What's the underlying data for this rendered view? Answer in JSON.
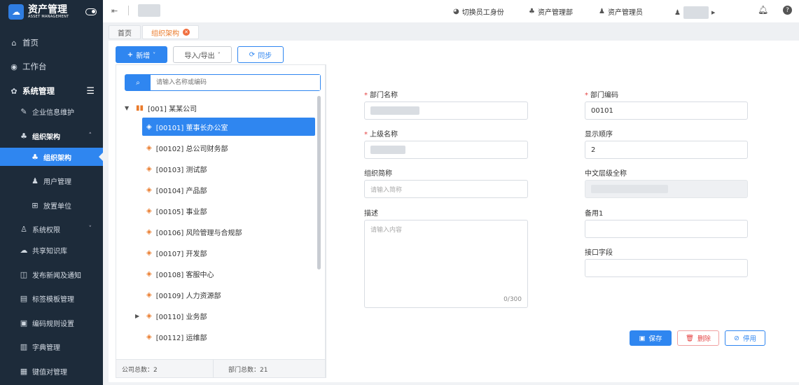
{
  "app": {
    "title": "资产管理",
    "subtitle": "ASSET MANAGEMENT",
    "logo_icon": "cloud-logo-icon"
  },
  "sidebar": {
    "items": [
      {
        "label": "首页",
        "icon": "home-icon"
      },
      {
        "label": "工作台",
        "icon": "workbench-icon"
      },
      {
        "label": "系统管理",
        "icon": "gear-icon"
      },
      {
        "label": "企业信息维护",
        "icon": "edit-icon"
      },
      {
        "label": "组织架构",
        "icon": "org-icon"
      },
      {
        "label": "组织架构",
        "icon": "org-icon"
      },
      {
        "label": "用户管理",
        "icon": "user-icon"
      },
      {
        "label": "放置单位",
        "icon": "unit-icon"
      },
      {
        "label": "系统权限",
        "icon": "permission-icon"
      },
      {
        "label": "共享知识库",
        "icon": "cloud-icon"
      },
      {
        "label": "发布新闻及通知",
        "icon": "news-icon"
      },
      {
        "label": "标签模板管理",
        "icon": "template-icon"
      },
      {
        "label": "编码规则设置",
        "icon": "code-icon"
      },
      {
        "label": "字典管理",
        "icon": "dict-icon"
      },
      {
        "label": "键值对管理",
        "icon": "kv-icon"
      }
    ]
  },
  "header": {
    "collapse_icon": "collapse-menu-icon",
    "switch_identity": "切换员工身份",
    "dept": "资产管理部",
    "role": "资产管理员",
    "bell_icon": "bell-icon",
    "help_icon": "help-icon"
  },
  "tabs": [
    {
      "label": "首页"
    },
    {
      "label": "组织架构"
    }
  ],
  "toolbar": {
    "add": "新增",
    "import_export": "导入/导出",
    "sync": "同步"
  },
  "tree": {
    "search_placeholder": "请输入名称或编码",
    "root": "[001] 某某公司",
    "nodes": [
      "[00101] 董事长办公室",
      "[00102] 总公司财务部",
      "[00103] 测试部",
      "[00104] 产品部",
      "[00105] 事业部",
      "[00106] 风险管理与合规部",
      "[00107] 开发部",
      "[00108] 客服中心",
      "[00109] 人力资源部",
      "[00110] 业务部",
      "[00112] 运维部"
    ],
    "company_count": "公司总数：2",
    "dept_count": "部门总数：21"
  },
  "form": {
    "dept_name_label": "部门名称",
    "dept_code_label": "部门编码",
    "dept_code_value": "00101",
    "parent_label": "上级名称",
    "order_label": "显示顺序",
    "order_value": "2",
    "abbr_label": "组织简称",
    "abbr_placeholder": "请输入简称",
    "fullname_label": "中文层级全称",
    "desc_label": "描述",
    "desc_placeholder": "请输入内容",
    "desc_counter": "0/300",
    "spare_label": "备用1",
    "api_label": "接口字段"
  },
  "actions": {
    "save": "保存",
    "delete": "删除",
    "disable": "停用"
  },
  "colors": {
    "primary": "#2f86f0",
    "sidebar": "#1d2b3a",
    "accent": "#ea7a2a",
    "danger": "#e54545"
  }
}
